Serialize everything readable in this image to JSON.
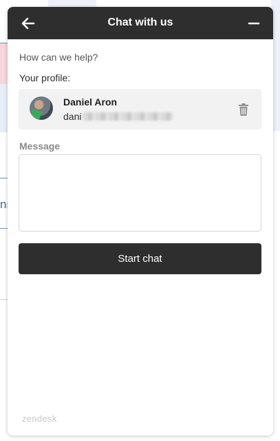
{
  "header": {
    "title": "Chat with us",
    "back_icon": "arrow-left-icon",
    "minimize_icon": "minus-icon"
  },
  "form": {
    "help_text": "How can we help?",
    "profile_label": "Your profile:",
    "profile": {
      "name": "Daniel Aron",
      "email_visible": "dani"
    },
    "message_label": "Message",
    "message_value": "",
    "start_chat_label": "Start chat"
  },
  "background": {
    "fragment_text": "nr"
  },
  "footer": {
    "brand": "zendesk"
  },
  "colors": {
    "header_bg": "#2e2e2e",
    "button_bg": "#2e2e2e",
    "card_bg": "#f2f2f2"
  }
}
